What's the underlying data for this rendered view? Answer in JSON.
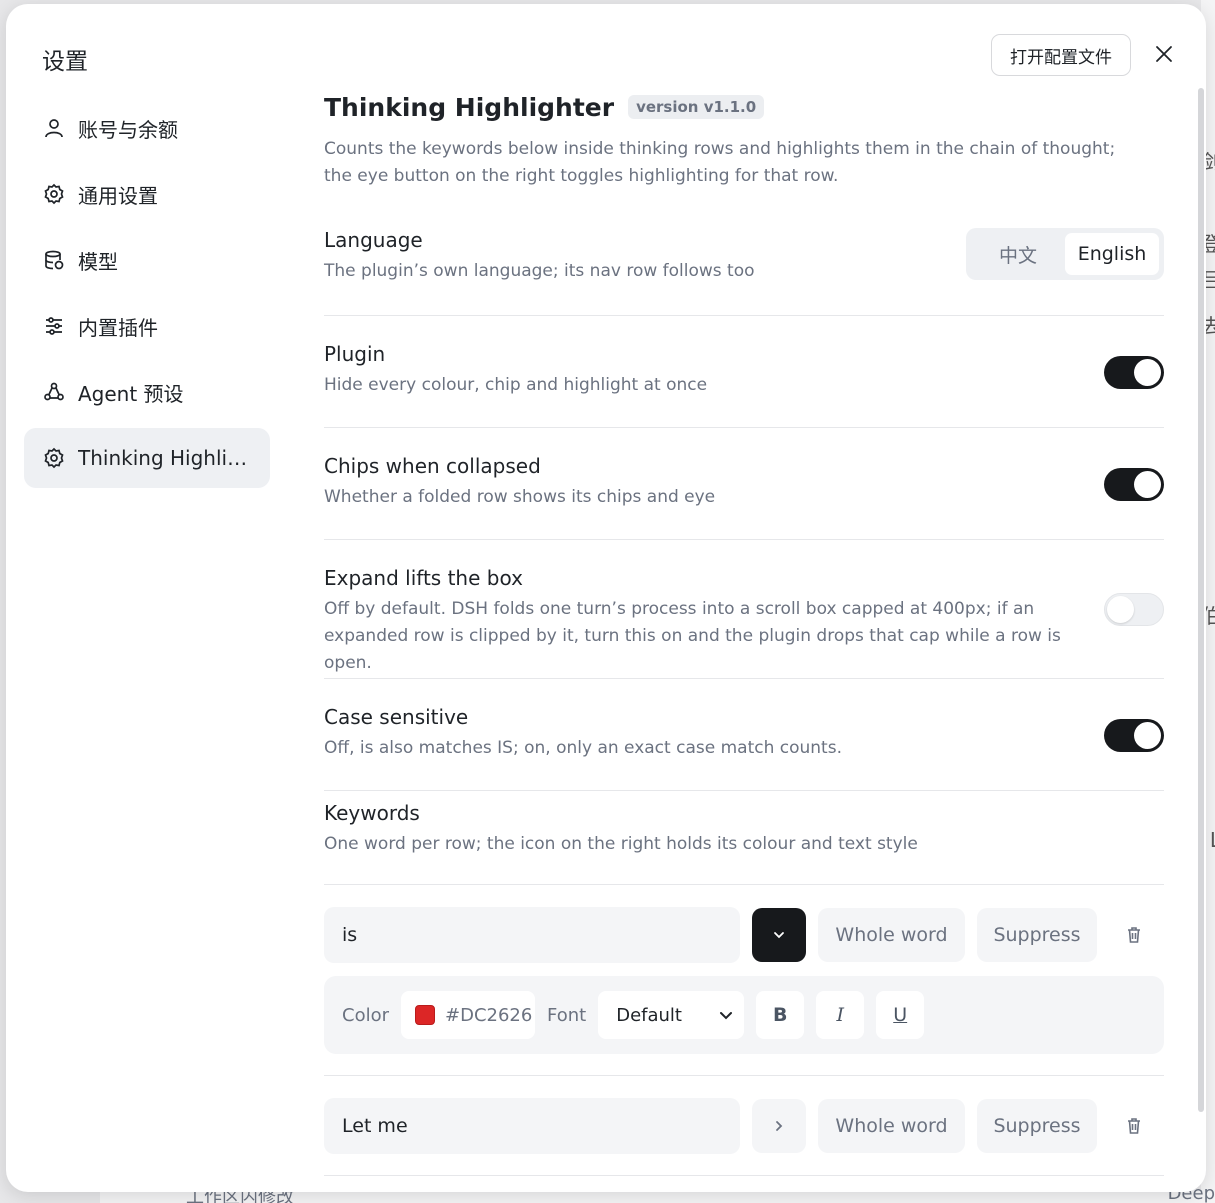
{
  "background": {
    "right_chars": [
      "剑",
      "登",
      "吕",
      "去",
      "伯",
      "L"
    ],
    "bottom_text": "工作区内修改",
    "bottom_right_text": "Deep"
  },
  "modal": {
    "title": "设置",
    "open_config_label": "打开配置文件"
  },
  "sidebar": {
    "items": [
      {
        "label": "账号与余额",
        "icon": "user-icon"
      },
      {
        "label": "通用设置",
        "icon": "gear-icon"
      },
      {
        "label": "模型",
        "icon": "database-icon"
      },
      {
        "label": "内置插件",
        "icon": "sliders-icon"
      },
      {
        "label": "Agent 预设",
        "icon": "agent-icon"
      },
      {
        "label": "Thinking Highlighter",
        "icon": "gear-icon",
        "active": true
      }
    ]
  },
  "plugin": {
    "title": "Thinking Highlighter",
    "version": "version v1.1.0",
    "description": "Counts the keywords below inside thinking rows and highlights them in the chain of thought; the eye button on the right toggles highlighting for that row."
  },
  "settings": {
    "language": {
      "name": "Language",
      "desc": "The plugin’s own language; its nav row follows too",
      "options": [
        "中文",
        "English"
      ],
      "selected": "English"
    },
    "plugin": {
      "name": "Plugin",
      "desc": "Hide every colour, chip and highlight at once",
      "on": true
    },
    "chips": {
      "name": "Chips when collapsed",
      "desc": "Whether a folded row shows its chips and eye",
      "on": true
    },
    "expand": {
      "name": "Expand lifts the box",
      "desc": "Off by default. DSH folds one turn’s process into a scroll box capped at 400px; if an expanded row is clipped by it, turn this on and the plugin drops that cap while a row is open.",
      "on": false
    },
    "case": {
      "name": "Case sensitive",
      "desc": "Off, is also matches IS; on, only an exact case match counts.",
      "on": true
    },
    "keywords": {
      "name": "Keywords",
      "desc": "One word per row; the icon on the right holds its colour and text style"
    }
  },
  "keywords": [
    {
      "word": "is",
      "expanded": true,
      "whole_word": "Whole word",
      "suppress": "Suppress",
      "style": {
        "color_label": "Color",
        "color": "#DC2626",
        "font_label": "Font",
        "font": "Default",
        "bold": "B",
        "italic": "I",
        "underline": "U"
      }
    },
    {
      "word": "Let me",
      "expanded": false,
      "whole_word": "Whole word",
      "suppress": "Suppress"
    }
  ]
}
